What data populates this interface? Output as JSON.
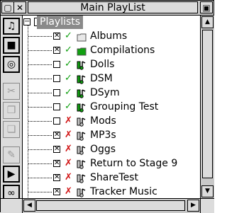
{
  "window": {
    "title": "Main PlayList",
    "back_icon": "▢",
    "close_icon": "✕",
    "toggle_icon": "▣"
  },
  "toolbar": {
    "buttons": [
      {
        "name": "playlist-icon",
        "glyph": "♫",
        "state": "on"
      },
      {
        "name": "folder-icon",
        "glyph": "■",
        "state": "on"
      },
      {
        "name": "cd-icon",
        "glyph": "◎",
        "state": "on"
      },
      {
        "name": "cut-icon",
        "glyph": "✂",
        "state": "disabled"
      },
      {
        "name": "copy-icon",
        "glyph": "❐",
        "state": "disabled"
      },
      {
        "name": "paste-icon",
        "glyph": "❏",
        "state": "disabled"
      },
      {
        "name": "edit-icon",
        "glyph": "✎",
        "state": "disabled"
      },
      {
        "name": "play-icon",
        "glyph": "▶",
        "state": "on"
      },
      {
        "name": "shuffle-icon",
        "glyph": "∞",
        "state": "on"
      }
    ]
  },
  "tree": {
    "root": {
      "label": "Playlists",
      "expander": "−"
    },
    "items": [
      {
        "label": "Albums",
        "checked": true,
        "tick": "✓",
        "tick_kind": "ok",
        "icon": "folder-empty",
        "icon_color": "#e8e8e8"
      },
      {
        "label": "Compilations",
        "checked": true,
        "tick": "✓",
        "tick_kind": "ok",
        "icon": "folder-filled",
        "icon_color": "#11a011"
      },
      {
        "label": "Dolls",
        "checked": false,
        "tick": "✓",
        "tick_kind": "ok",
        "icon": "music-note",
        "icon_color": "#11a011"
      },
      {
        "label": "DSM",
        "checked": false,
        "tick": "✓",
        "tick_kind": "ok",
        "icon": "music-note",
        "icon_color": "#11a011"
      },
      {
        "label": "DSym",
        "checked": false,
        "tick": "✓",
        "tick_kind": "ok",
        "icon": "music-note",
        "icon_color": "#11a011"
      },
      {
        "label": "Grouping Test",
        "checked": false,
        "tick": "✓",
        "tick_kind": "ok",
        "icon": "music-note",
        "icon_color": "#11a011"
      },
      {
        "label": "Mods",
        "checked": false,
        "tick": "✗",
        "tick_kind": "no",
        "icon": "music-note",
        "icon_color": "#c8c8c8"
      },
      {
        "label": "MP3s",
        "checked": true,
        "tick": "✗",
        "tick_kind": "no",
        "icon": "music-note",
        "icon_color": "#c8c8c8"
      },
      {
        "label": "Oggs",
        "checked": true,
        "tick": "✗",
        "tick_kind": "no",
        "icon": "music-note",
        "icon_color": "#c8c8c8"
      },
      {
        "label": "Return to Stage 9",
        "checked": true,
        "tick": "✗",
        "tick_kind": "no",
        "icon": "music-note",
        "icon_color": "#c8c8c8"
      },
      {
        "label": "ShareTest",
        "checked": true,
        "tick": "✗",
        "tick_kind": "no",
        "icon": "music-note",
        "icon_color": "#c8c8c8"
      },
      {
        "label": "Tracker Music",
        "checked": true,
        "tick": "✗",
        "tick_kind": "no",
        "icon": "music-note",
        "icon_color": "#c8c8c8"
      }
    ]
  },
  "scrollbars": {
    "up_arrow": "▲",
    "down_arrow": "▼",
    "left_arrow": "◀",
    "right_arrow": "▶"
  }
}
